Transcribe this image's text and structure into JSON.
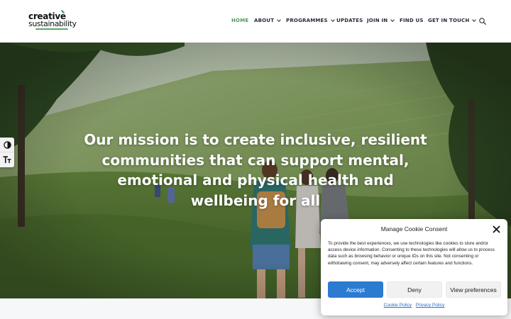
{
  "logo": {
    "line1": "creative",
    "line2": "sustainability"
  },
  "nav": {
    "items": [
      {
        "label": "HOME",
        "active": true,
        "dropdown": false
      },
      {
        "label": "ABOUT",
        "active": false,
        "dropdown": true
      },
      {
        "label": "PROGRAMMES",
        "active": false,
        "dropdown": true
      },
      {
        "label": "UPDATES",
        "active": false,
        "dropdown": false
      },
      {
        "label": "JOIN IN",
        "active": false,
        "dropdown": true
      },
      {
        "label": "FIND US",
        "active": false,
        "dropdown": false
      },
      {
        "label": "GET IN TOUCH",
        "active": false,
        "dropdown": true
      }
    ],
    "search_icon": "search-icon"
  },
  "hero": {
    "headline": "Our mission is to create inclusive, resilient communities that can support mental, emotional and physical health and wellbeing for all"
  },
  "accessibility": {
    "contrast_icon": "contrast-icon",
    "font_size_icon": "font-size-icon"
  },
  "cookie": {
    "title": "Manage Cookie Consent",
    "body": "To provide the best experiences, we use technologies like cookies to store and/or access device information. Consenting to these technologies will allow us to process data such as browsing behavior or unique IDs on this site. Not consenting or withdrawing consent, may adversely affect certain features and functions.",
    "accept_label": "Accept",
    "deny_label": "Deny",
    "preferences_label": "View preferences",
    "cookie_policy_label": "Cookie Policy",
    "privacy_policy_label": "Privacy Policy"
  },
  "colors": {
    "accent_green": "#4e9a5a",
    "accept_blue": "#2b7bd1",
    "link_blue": "#2b6cc4"
  }
}
